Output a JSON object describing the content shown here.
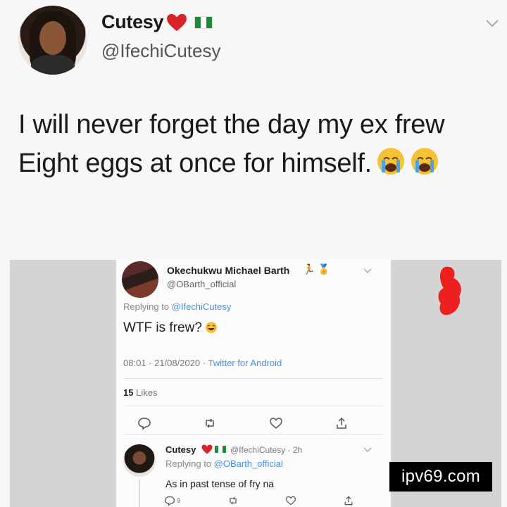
{
  "tweet": {
    "display_name": "Cutesy",
    "handle": "@IfechiCutesy",
    "text_line1": "I will never forget the day my ex frew",
    "text_line2": "Eight eggs at once for himself.",
    "icons": [
      "heart-emoji",
      "nigeria-flag",
      "chevron-down",
      "crying-emoji"
    ]
  },
  "embed": {
    "reply_tweet": {
      "display_name": "Okechukwu Michael Barth",
      "badges": "🏃 🏅",
      "handle": "@OBarth_official",
      "replying_prefix": "Replying to ",
      "replying_to": "@IfechiCutesy",
      "text": "WTF is frew?",
      "timestamp": "08:01 · 21/08/2020 · ",
      "source": "Twitter for Android",
      "likes_count": "15",
      "likes_label": "Likes"
    },
    "second_reply": {
      "display_name": "Cutesy",
      "meta": "@IfechiCutesy · 2h",
      "replying_prefix": "Replying to ",
      "replying_to": "@OBarth_official",
      "text": "As in past tense of fry na",
      "reply_count": "9"
    }
  },
  "watermark": "ipv69.com",
  "colors": {
    "link_blue": "#4a90e2",
    "heart_red": "#d9232a",
    "flag_green": "#1f8a3a"
  }
}
